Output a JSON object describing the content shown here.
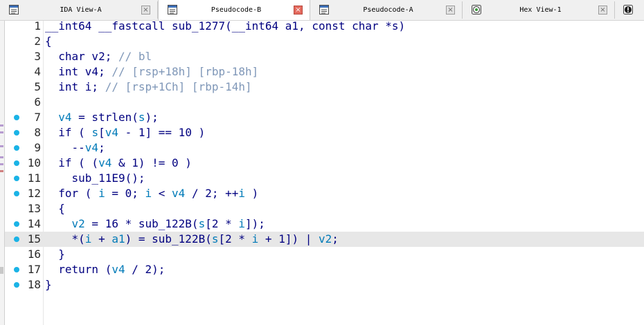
{
  "tabs": [
    {
      "label": "IDA View-A",
      "icon": "ida-view-icon",
      "active": false
    },
    {
      "label": "Pseudocode-B",
      "icon": "pseudocode-icon",
      "active": true
    },
    {
      "label": "Pseudocode-A",
      "icon": "pseudocode-icon",
      "active": false
    },
    {
      "label": "Hex View-1",
      "icon": "hex-view-icon",
      "active": false
    }
  ],
  "close_glyph": "×",
  "lines": [
    {
      "no": "1",
      "bp": false,
      "hl": false,
      "segs": [
        [
          "__int64 __fastcall sub_1277(__int64 a1, const char *s)",
          ""
        ]
      ]
    },
    {
      "no": "2",
      "bp": false,
      "hl": false,
      "segs": [
        [
          "{",
          ""
        ]
      ]
    },
    {
      "no": "3",
      "bp": false,
      "hl": false,
      "segs": [
        [
          "  char v2; ",
          ""
        ],
        [
          "// bl",
          "c"
        ]
      ]
    },
    {
      "no": "4",
      "bp": false,
      "hl": false,
      "segs": [
        [
          "  int v4; ",
          ""
        ],
        [
          "// [rsp+18h] [rbp-18h]",
          "c"
        ]
      ]
    },
    {
      "no": "5",
      "bp": false,
      "hl": false,
      "segs": [
        [
          "  int i; ",
          ""
        ],
        [
          "// [rsp+1Ch] [rbp-14h]",
          "c"
        ]
      ]
    },
    {
      "no": "6",
      "bp": false,
      "hl": false,
      "segs": [
        [
          "",
          ""
        ]
      ]
    },
    {
      "no": "7",
      "bp": true,
      "hl": false,
      "segs": [
        [
          "  ",
          ""
        ],
        [
          "v4",
          "v"
        ],
        [
          " = strlen(",
          ""
        ],
        [
          "s",
          "v"
        ],
        [
          ");",
          ""
        ]
      ]
    },
    {
      "no": "8",
      "bp": true,
      "hl": false,
      "segs": [
        [
          "  if ( ",
          ""
        ],
        [
          "s",
          "v"
        ],
        [
          "[",
          ""
        ],
        [
          "v4",
          "v"
        ],
        [
          " - 1] == 10 )",
          ""
        ]
      ]
    },
    {
      "no": "9",
      "bp": true,
      "hl": false,
      "segs": [
        [
          "    --",
          ""
        ],
        [
          "v4",
          "v"
        ],
        [
          ";",
          ""
        ]
      ]
    },
    {
      "no": "10",
      "bp": true,
      "hl": false,
      "segs": [
        [
          "  if ( (",
          ""
        ],
        [
          "v4",
          "v"
        ],
        [
          " & 1) != 0 )",
          ""
        ]
      ]
    },
    {
      "no": "11",
      "bp": true,
      "hl": false,
      "segs": [
        [
          "    sub_11E9();",
          ""
        ]
      ]
    },
    {
      "no": "12",
      "bp": true,
      "hl": false,
      "segs": [
        [
          "  for ( ",
          ""
        ],
        [
          "i",
          "v"
        ],
        [
          " = 0; ",
          ""
        ],
        [
          "i",
          "v"
        ],
        [
          " < ",
          ""
        ],
        [
          "v4",
          "v"
        ],
        [
          " / 2; ++",
          ""
        ],
        [
          "i",
          "v"
        ],
        [
          " )",
          ""
        ]
      ]
    },
    {
      "no": "13",
      "bp": false,
      "hl": false,
      "segs": [
        [
          "  {",
          ""
        ]
      ]
    },
    {
      "no": "14",
      "bp": true,
      "hl": false,
      "segs": [
        [
          "    ",
          ""
        ],
        [
          "v2",
          "v"
        ],
        [
          " = 16 * sub_122B(",
          ""
        ],
        [
          "s",
          "v"
        ],
        [
          "[2 * ",
          ""
        ],
        [
          "i",
          "v"
        ],
        [
          "]);",
          ""
        ]
      ]
    },
    {
      "no": "15",
      "bp": true,
      "hl": true,
      "segs": [
        [
          "    *(",
          ""
        ],
        [
          "i",
          "v"
        ],
        [
          " + ",
          ""
        ],
        [
          "a1",
          "v"
        ],
        [
          ") = sub_122B(",
          ""
        ],
        [
          "s",
          "v"
        ],
        [
          "[2 * ",
          ""
        ],
        [
          "i",
          "v"
        ],
        [
          " + 1]) | ",
          ""
        ],
        [
          "v2",
          "v"
        ],
        [
          ";",
          ""
        ]
      ]
    },
    {
      "no": "16",
      "bp": false,
      "hl": false,
      "segs": [
        [
          "  }",
          ""
        ]
      ]
    },
    {
      "no": "17",
      "bp": true,
      "hl": false,
      "segs": [
        [
          "  return (",
          ""
        ],
        [
          "v4",
          "v"
        ],
        [
          " / 2);",
          ""
        ]
      ]
    },
    {
      "no": "18",
      "bp": true,
      "hl": false,
      "segs": [
        [
          "}",
          ""
        ]
      ]
    }
  ],
  "colors": {
    "keyword": "#000080",
    "variable": "#007ab8",
    "comment": "#7f97b8",
    "breakpoint_dot": "#1ab3e6",
    "highlight": "#e7e7e7"
  }
}
